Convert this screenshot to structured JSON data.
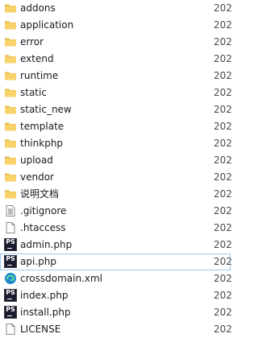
{
  "files": [
    {
      "name": "addons",
      "date": "202",
      "icon": "folder-icon",
      "type": "folder"
    },
    {
      "name": "application",
      "date": "202",
      "icon": "folder-icon",
      "type": "folder"
    },
    {
      "name": "error",
      "date": "202",
      "icon": "folder-icon",
      "type": "folder"
    },
    {
      "name": "extend",
      "date": "202",
      "icon": "folder-icon",
      "type": "folder"
    },
    {
      "name": "runtime",
      "date": "202",
      "icon": "folder-icon",
      "type": "folder"
    },
    {
      "name": "static",
      "date": "202",
      "icon": "folder-icon",
      "type": "folder"
    },
    {
      "name": "static_new",
      "date": "202",
      "icon": "folder-icon",
      "type": "folder"
    },
    {
      "name": "template",
      "date": "202",
      "icon": "folder-icon",
      "type": "folder"
    },
    {
      "name": "thinkphp",
      "date": "202",
      "icon": "folder-icon",
      "type": "folder"
    },
    {
      "name": "upload",
      "date": "202",
      "icon": "folder-icon",
      "type": "folder"
    },
    {
      "name": "vendor",
      "date": "202",
      "icon": "folder-icon",
      "type": "folder"
    },
    {
      "name": "说明文档",
      "date": "202",
      "icon": "folder-icon",
      "type": "folder"
    },
    {
      "name": ".gitignore",
      "date": "202",
      "icon": "text-file-icon",
      "type": "text"
    },
    {
      "name": ".htaccess",
      "date": "202",
      "icon": "blank-file-icon",
      "type": "blank"
    },
    {
      "name": "admin.php",
      "date": "202",
      "icon": "phpstorm-file-icon",
      "type": "php"
    },
    {
      "name": "api.php",
      "date": "202",
      "icon": "phpstorm-file-icon",
      "type": "php",
      "selected": true
    },
    {
      "name": "crossdomain.xml",
      "date": "202",
      "icon": "edge-file-icon",
      "type": "xml"
    },
    {
      "name": "index.php",
      "date": "202",
      "icon": "phpstorm-file-icon",
      "type": "php"
    },
    {
      "name": "install.php",
      "date": "202",
      "icon": "phpstorm-file-icon",
      "type": "php"
    },
    {
      "name": "LICENSE",
      "date": "202",
      "icon": "blank-file-icon",
      "type": "blank"
    }
  ],
  "colors": {
    "folder": "#f8d26a",
    "selection_border": "#99c9ef"
  }
}
